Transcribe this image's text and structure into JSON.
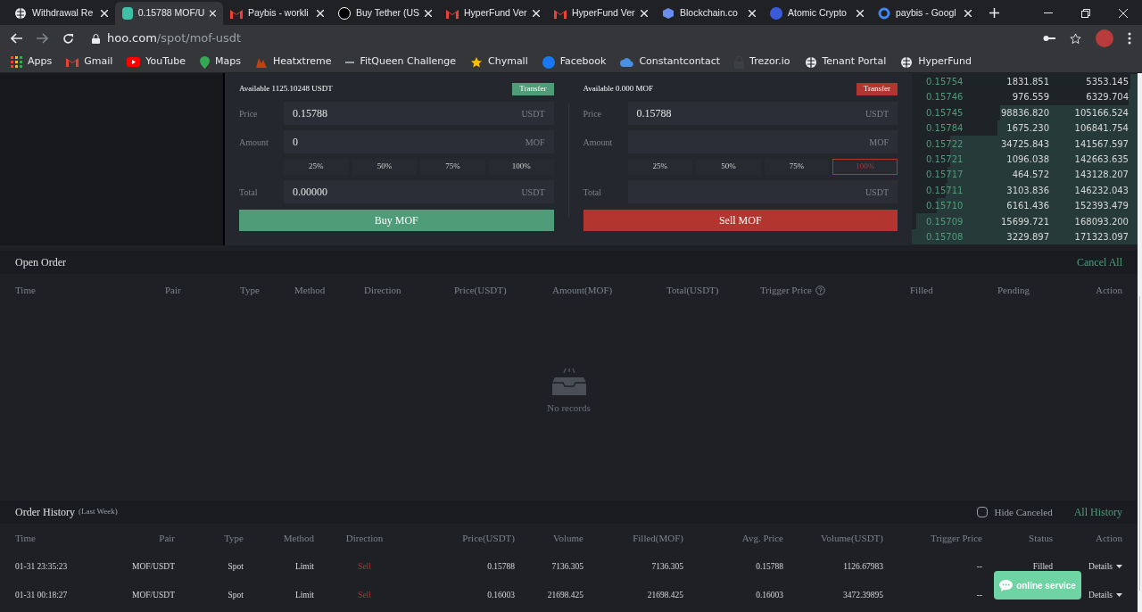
{
  "browser": {
    "tabs": [
      {
        "title": "Withdrawal Re",
        "selected": false
      },
      {
        "title": "0.15788 MOF/U",
        "selected": true
      },
      {
        "title": "Paybis - workli",
        "selected": false
      },
      {
        "title": "Buy Tether (US",
        "selected": false
      },
      {
        "title": "HyperFund Ver",
        "selected": false
      },
      {
        "title": "HyperFund Ver",
        "selected": false
      },
      {
        "title": "Blockchain.co",
        "selected": false
      },
      {
        "title": "Atomic Crypto",
        "selected": false
      },
      {
        "title": "paybis - Googl",
        "selected": false
      }
    ],
    "url_host": "hoo.com",
    "url_path": "/spot/mof-usdt",
    "bookmarks": [
      {
        "label": "Apps"
      },
      {
        "label": "Gmail"
      },
      {
        "label": "YouTube"
      },
      {
        "label": "Maps"
      },
      {
        "label": "Heatxtreme"
      },
      {
        "label": "FitQueen Challenge"
      },
      {
        "label": "Chymall"
      },
      {
        "label": "Facebook"
      },
      {
        "label": "Constantcontact"
      },
      {
        "label": "Trezor.io"
      },
      {
        "label": "Tenant Portal"
      },
      {
        "label": "HyperFund"
      }
    ]
  },
  "trade": {
    "forms": [
      {
        "kind": "buy",
        "available": "Available 1125.10248 USDT",
        "transfer": "Transfer",
        "fields": [
          {
            "label": "Price",
            "value": "0.15788",
            "unit": "USDT"
          },
          {
            "label": "Amount",
            "value": "0",
            "unit": "MOF"
          },
          {
            "label": "Total",
            "value": "0.00000",
            "unit": "USDT"
          }
        ],
        "percents": [
          {
            "label": "25%",
            "selected": false
          },
          {
            "label": "50%",
            "selected": false
          },
          {
            "label": "75%",
            "selected": false
          },
          {
            "label": "100%",
            "selected": false
          }
        ],
        "submit": "Buy MOF"
      },
      {
        "kind": "sell",
        "available": "Available 0.000 MOF",
        "transfer": "Transfer",
        "fields": [
          {
            "label": "Price",
            "value": "0.15788",
            "unit": "USDT"
          },
          {
            "label": "Amount",
            "unit": "MOF"
          },
          {
            "label": "Total",
            "unit": "USDT"
          }
        ],
        "percents": [
          {
            "label": "25%",
            "selected": false
          },
          {
            "label": "50%",
            "selected": false
          },
          {
            "label": "75%",
            "selected": false
          },
          {
            "label": "100%",
            "selected": true
          }
        ],
        "submit": "Sell MOF"
      }
    ]
  },
  "order_book": [
    {
      "price": "0.15754",
      "amount": "1831.851",
      "total": "5353.145",
      "level": 0.03
    },
    {
      "price": "0.15746",
      "amount": "976.559",
      "total": "6329.704",
      "level": 0.04
    },
    {
      "price": "0.15745",
      "amount": "98836.820",
      "total": "105166.524",
      "level": 0.61
    },
    {
      "price": "0.15784",
      "amount": "1675.230",
      "total": "106841.754",
      "level": 0.62
    },
    {
      "price": "0.15722",
      "amount": "34725.843",
      "total": "141567.597",
      "level": 0.83
    },
    {
      "price": "0.15721",
      "amount": "1096.038",
      "total": "142663.635",
      "level": 0.83
    },
    {
      "price": "0.15717",
      "amount": "464.572",
      "total": "143128.207",
      "level": 0.84
    },
    {
      "price": "0.15711",
      "amount": "3103.836",
      "total": "146232.043",
      "level": 0.85
    },
    {
      "price": "0.15710",
      "amount": "6161.436",
      "total": "152393.479",
      "level": 0.89
    },
    {
      "price": "0.15709",
      "amount": "15699.721",
      "total": "168093.200",
      "level": 0.98
    },
    {
      "price": "0.15708",
      "amount": "3229.897",
      "total": "171323.097",
      "level": 1.0
    }
  ],
  "open_order": {
    "title": "Open Order",
    "cancel_all": "Cancel All",
    "columns": [
      "Time",
      "Pair",
      "Type",
      "Method",
      "Direction",
      "Price(USDT)",
      "Amount(MOF)",
      "Total(USDT)",
      "Trigger Price",
      "Filled",
      "Pending",
      "Action"
    ],
    "empty": "No records"
  },
  "order_history": {
    "title": "Order History",
    "subtitle": "(Last Week)",
    "hide_canceled": {
      "label": "Hide Canceled",
      "checked": false
    },
    "all_history": "All History",
    "columns": [
      "Time",
      "Pair",
      "Type",
      "Method",
      "Direction",
      "Price(USDT)",
      "Volume",
      "Filled(MOF)",
      "Avg. Price",
      "Volume(USDT)",
      "Trigger Price",
      "Status",
      "Action"
    ],
    "rows": [
      {
        "cells": [
          "01-31 23:35:23",
          "MOF/USDT",
          "Spot",
          "Limit",
          "Sell",
          "0.15788",
          "7136.305",
          "7136.305",
          "0.15788",
          "1126.67983",
          "--",
          "Filled"
        ],
        "kind": "sell",
        "action": "Details"
      },
      {
        "cells": [
          "01-31 00:18:27",
          "MOF/USDT",
          "Spot",
          "Limit",
          "Sell",
          "0.16003",
          "21698.425",
          "21698.425",
          "0.16003",
          "3472.39895",
          "--"
        ],
        "kind": "sell",
        "action": "Details"
      }
    ]
  },
  "chat_button": "online service"
}
